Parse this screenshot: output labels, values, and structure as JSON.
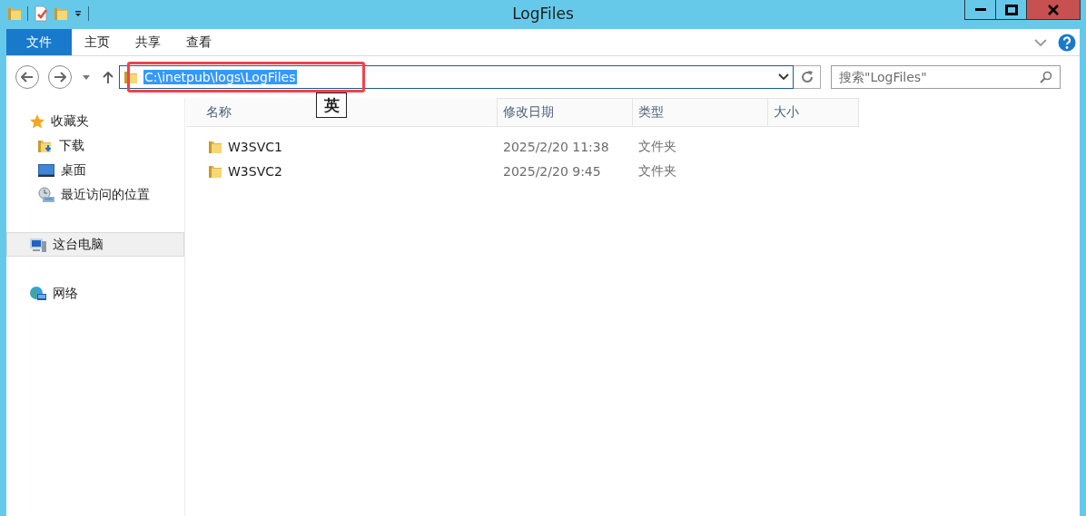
{
  "window": {
    "title": "LogFiles"
  },
  "ribbon": {
    "tabs": [
      {
        "label": "文件",
        "kind": "file",
        "selected": false
      },
      {
        "label": "主页",
        "kind": "tab",
        "selected": false
      },
      {
        "label": "共享",
        "kind": "tab",
        "selected": false
      },
      {
        "label": "查看",
        "kind": "tab",
        "selected": false
      }
    ]
  },
  "address": {
    "path": "C:\\inetpub\\logs\\LogFiles",
    "text_selected": true,
    "highlighted": true
  },
  "search": {
    "placeholder": "搜索\"LogFiles\""
  },
  "ime_indicator": "英",
  "sidebar": {
    "items": [
      {
        "label": "收藏夹",
        "kind": "star",
        "selected": false,
        "children": [
          {
            "label": "下载",
            "kind": "download",
            "selected": false
          },
          {
            "label": "桌面",
            "kind": "desktop",
            "selected": false
          },
          {
            "label": "最近访问的位置",
            "kind": "recent",
            "selected": false
          }
        ]
      },
      {
        "label": "这台电脑",
        "kind": "computer",
        "selected": true
      },
      {
        "label": "网络",
        "kind": "network",
        "selected": false
      }
    ]
  },
  "table": {
    "columns": [
      "名称",
      "修改日期",
      "类型",
      "大小"
    ],
    "rows": [
      {
        "name": "W3SVC1",
        "modified": "2025/2/20 11:38",
        "type": "文件夹"
      },
      {
        "name": "W3SVC2",
        "modified": "2025/2/20 9:45",
        "type": "文件夹"
      }
    ]
  }
}
